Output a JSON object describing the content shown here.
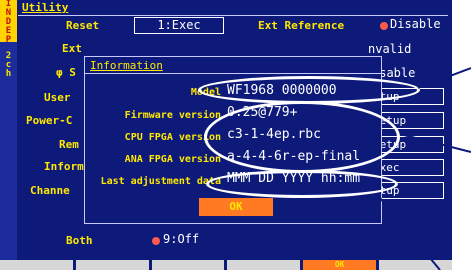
{
  "side": {
    "indep": "INDEP",
    "channel": "2ch"
  },
  "header": {
    "title": "Utility"
  },
  "settings": {
    "reset": {
      "label": "Reset",
      "value": "1:Exec"
    },
    "ext_reference": {
      "label": "Ext Reference",
      "value": "Disable"
    },
    "ext": {
      "label": "Ext",
      "value": "nvalid"
    },
    "phase_sync": {
      "label": "φ S",
      "value": "isable"
    },
    "user": {
      "label": "User",
      "value": "etup"
    },
    "power_on": {
      "label": "Power-C",
      "value": "Setup"
    },
    "remote": {
      "label": "Rem",
      "value": "Setup"
    },
    "information": {
      "label": "Inform",
      "value": "Exec"
    },
    "channel": {
      "label": "Channe",
      "value": "etup"
    },
    "both": {
      "label": "Both",
      "value": "9:Off"
    }
  },
  "dialog": {
    "title": "Information",
    "model": {
      "label": "Model",
      "value": "WF1968 0000000"
    },
    "firmware": {
      "label": "Firmware version",
      "value": "0.25@779+"
    },
    "cpu_fpga": {
      "label": "CPU FPGA version",
      "value": "c3-1-4ep.rbc"
    },
    "ana_fpga": {
      "label": "ANA FPGA version",
      "value": "a-4-4-6r-ep-final"
    },
    "last_adjustment": {
      "label": "Last adjustment data",
      "value": "MMM DD YYYY hh:mm"
    },
    "ok_label": "OK"
  },
  "function_keys": {
    "ok_label": "OK"
  },
  "colors": {
    "screen_bg": "#0d1a7a",
    "label_yellow": "#ffe800",
    "ok_orange": "#ff7a22",
    "indicator_red": "#ff5a4a"
  }
}
